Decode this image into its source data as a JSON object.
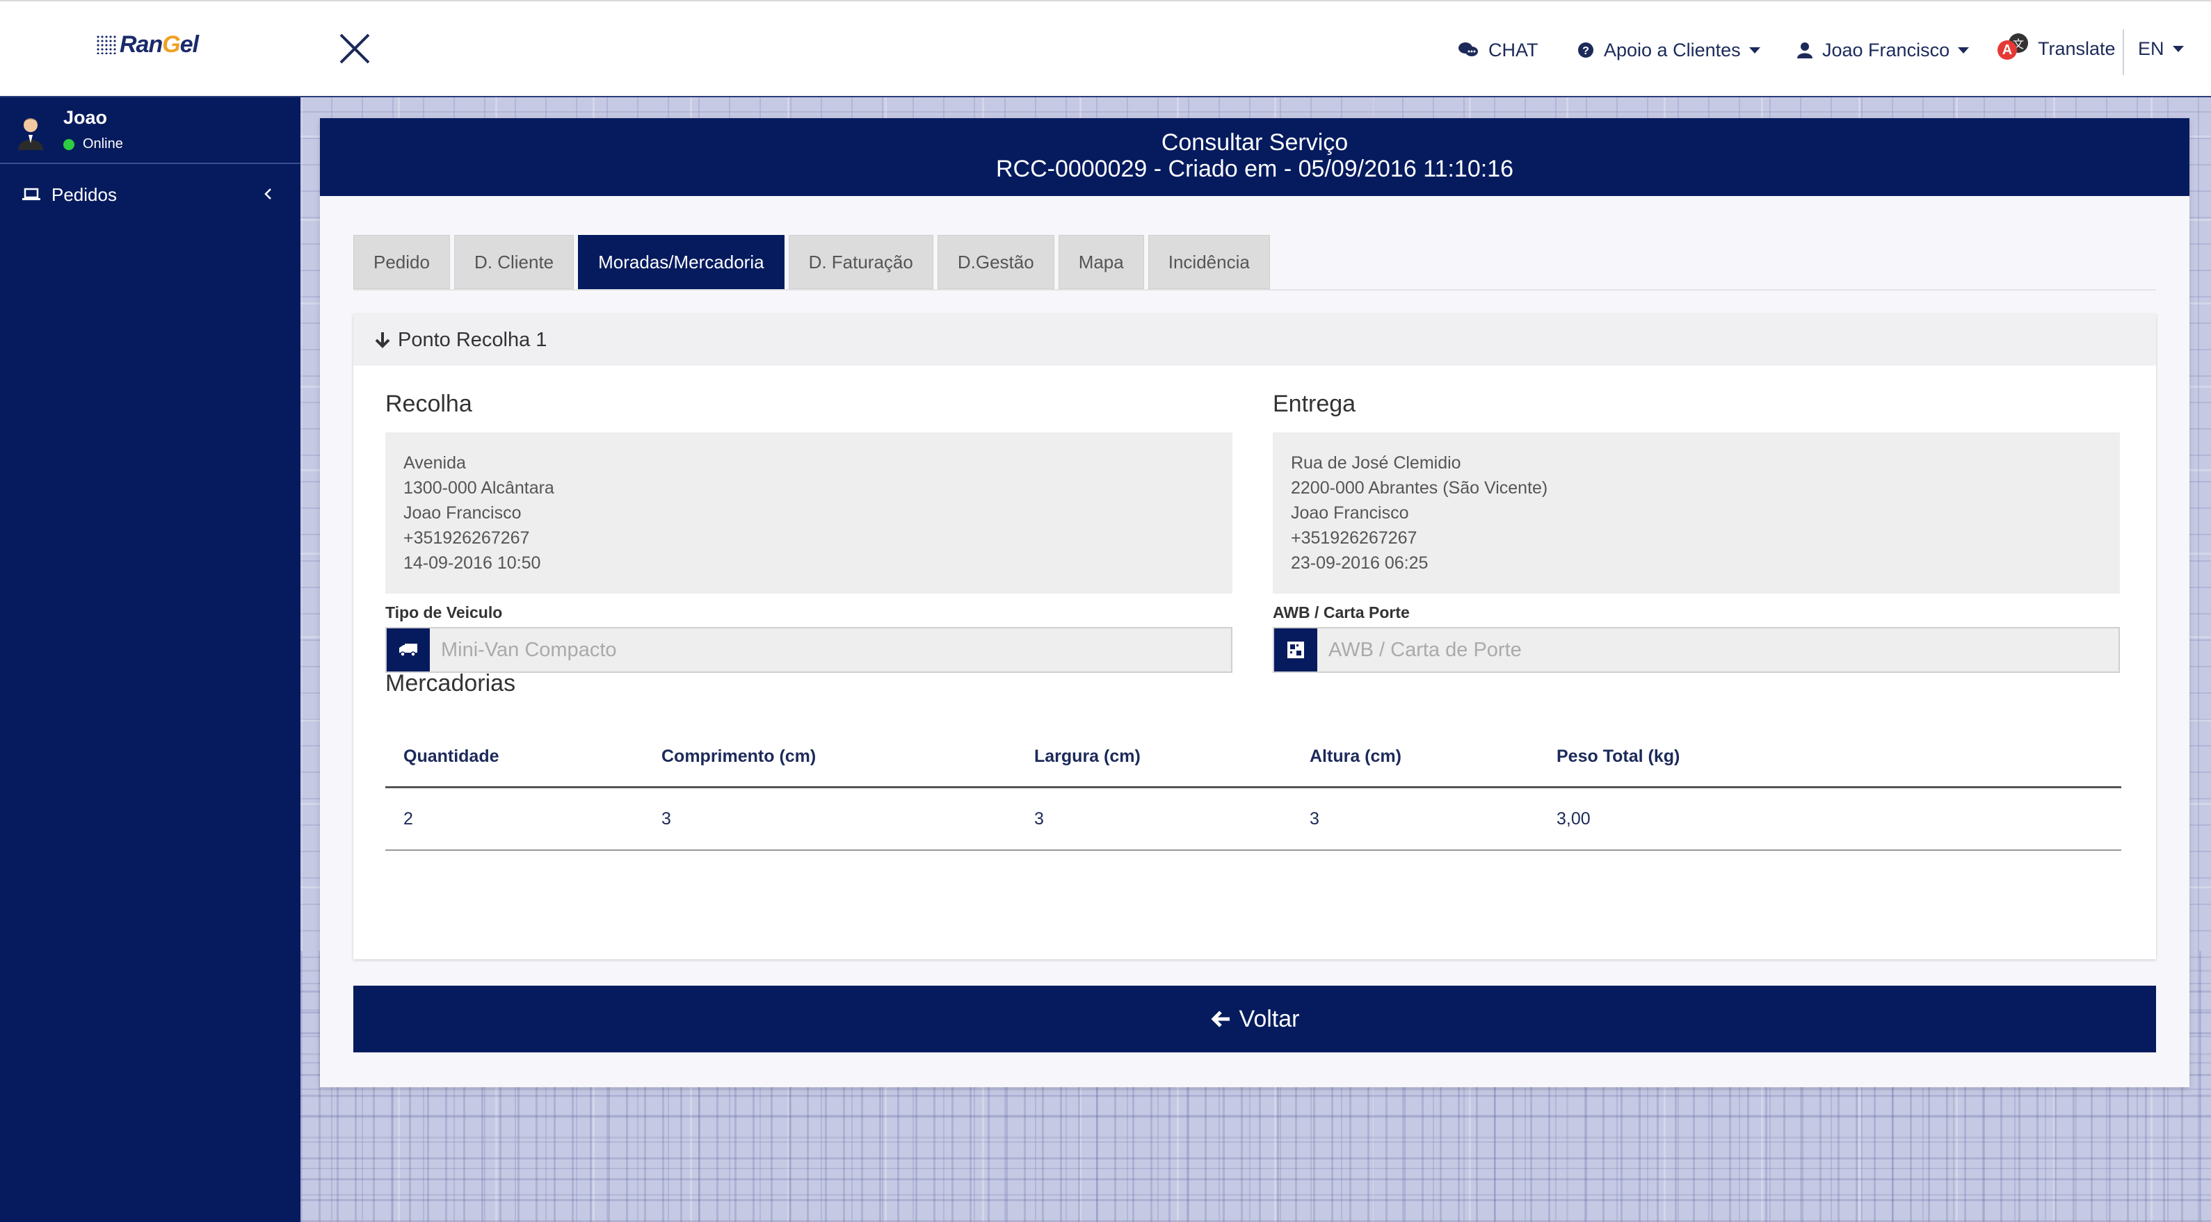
{
  "header": {
    "logo_text_a": "Ran",
    "logo_text_g": "G",
    "logo_text_b": "el",
    "chat_label": "CHAT",
    "support_label": "Apoio a Clientes",
    "user_label": "Joao Francisco",
    "translate_label": "Translate",
    "translate_badge": "A",
    "language": "EN"
  },
  "sidebar": {
    "user_name": "Joao",
    "user_status": "Online",
    "status_color": "#2ecc40",
    "items": [
      {
        "label": "Pedidos",
        "icon": "laptop-icon"
      }
    ]
  },
  "panel": {
    "title": "Consultar Serviço",
    "subtitle": "RCC-0000029 - Criado em - 05/09/2016 11:10:16",
    "tabs": [
      {
        "label": "Pedido",
        "active": false
      },
      {
        "label": "D. Cliente",
        "active": false
      },
      {
        "label": "Moradas/Mercadoria",
        "active": true
      },
      {
        "label": "D. Faturação",
        "active": false
      },
      {
        "label": "D.Gestão",
        "active": false
      },
      {
        "label": "Mapa",
        "active": false
      },
      {
        "label": "Incidência",
        "active": false
      }
    ],
    "point_title": "Ponto Recolha 1",
    "pickup": {
      "title": "Recolha",
      "lines": [
        "Avenida",
        "1300-000 Alcântara",
        "Joao Francisco",
        "+351926267267",
        "14-09-2016 10:50"
      ],
      "field_label": "Tipo de Veiculo",
      "field_placeholder": "Mini-Van Compacto",
      "field_icon": "truck-icon"
    },
    "delivery": {
      "title": "Entrega",
      "lines": [
        "Rua de José Clemidio",
        "2200-000 Abrantes (São Vicente)",
        "Joao Francisco",
        "+351926267267",
        "23-09-2016 06:25"
      ],
      "field_label": "AWB / Carta Porte",
      "field_placeholder": "AWB / Carta de Porte",
      "field_icon": "qrcode-icon"
    },
    "goods": {
      "title": "Mercadorias",
      "columns": [
        "Quantidade",
        "Comprimento (cm)",
        "Largura (cm)",
        "Altura (cm)",
        "Peso Total (kg)"
      ],
      "rows": [
        [
          "2",
          "3",
          "3",
          "3",
          "3,00"
        ]
      ]
    },
    "back_label": "Voltar"
  },
  "colors": {
    "primary": "#061b5e",
    "accent": "#f0a020",
    "badge": "#e53935"
  }
}
